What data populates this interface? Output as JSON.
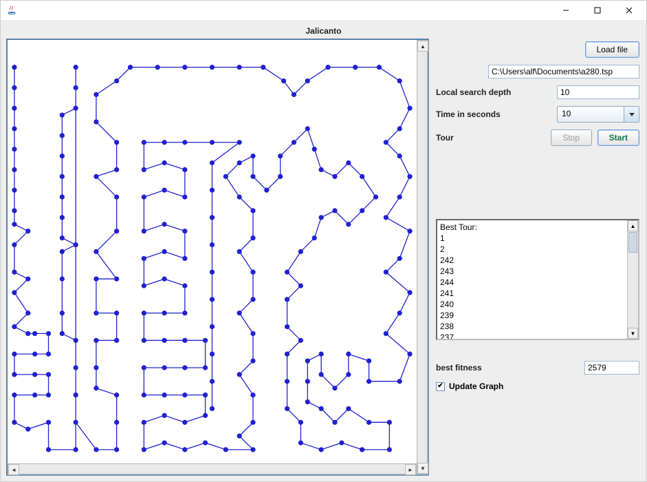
{
  "window": {
    "title": "",
    "min_tooltip": "Minimize",
    "max_tooltip": "Maximize",
    "close_tooltip": "Close"
  },
  "app": {
    "title": "Jalicanto"
  },
  "controls": {
    "load_file_label": "Load file",
    "file_path": "C:\\Users\\alf\\Documents\\a280.tsp",
    "local_search_label": "Local search depth",
    "local_search_value": "10",
    "time_label": "Time in seconds",
    "time_value": "10",
    "tour_label": "Tour",
    "stop_label": "Stop",
    "start_label": "Start"
  },
  "log": {
    "text": "Best Tour:\n1\n2\n242\n243\n244\n241\n240\n239\n238\n237"
  },
  "fitness": {
    "label": "best fitness",
    "value": "2579"
  },
  "update_graph": {
    "label": "Update Graph",
    "checked": true
  },
  "icons": {
    "java": "java-icon",
    "dropdown": "chevron-down-icon"
  }
}
